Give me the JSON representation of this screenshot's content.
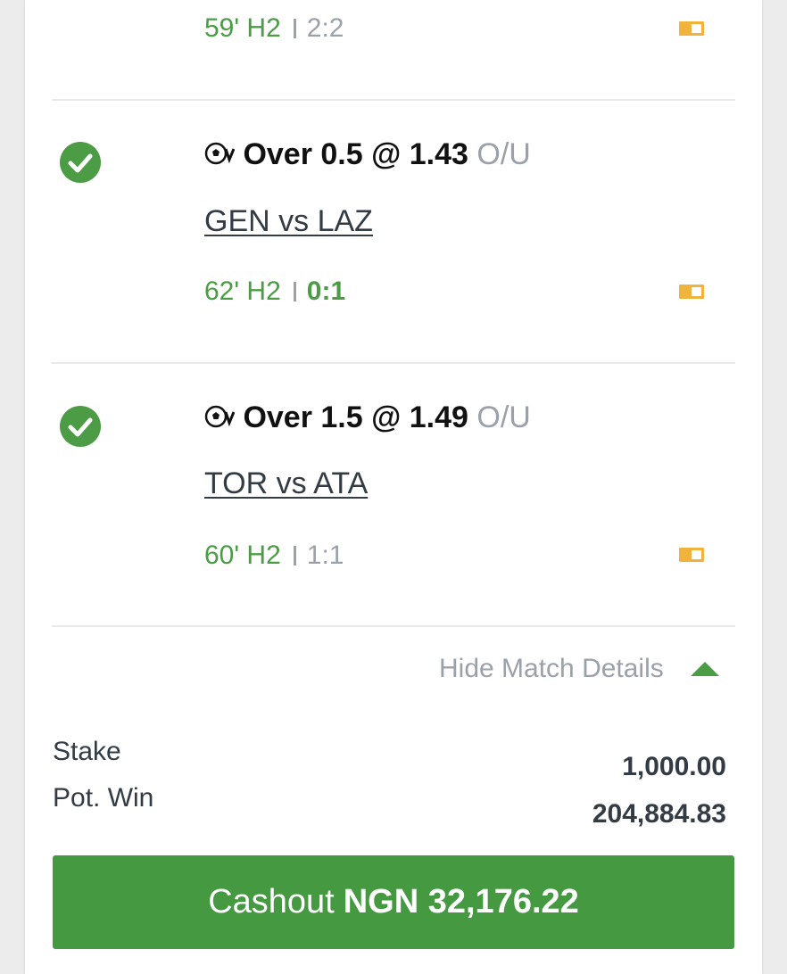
{
  "colors": {
    "accent_green": "#459a41",
    "text_green": "#4b9c45",
    "muted_grey": "#9aa1aa",
    "flag_yellow": "#f0b43c"
  },
  "bets": [
    {
      "status_icon": "check-circle-icon",
      "live": {
        "minute": "59' H2",
        "score": "2:2"
      }
    },
    {
      "status_icon": "check-circle-icon",
      "selection": "Over 0.5",
      "at": "@",
      "odds": "1.43",
      "market": "O/U",
      "match": "GEN vs LAZ",
      "live": {
        "minute": "62' H2",
        "score": "0:1"
      }
    },
    {
      "status_icon": "check-circle-icon",
      "selection": "Over 1.5",
      "at": "@",
      "odds": "1.49",
      "market": "O/U",
      "match": "TOR vs ATA",
      "live": {
        "minute": "60' H2",
        "score": "1:1"
      }
    }
  ],
  "details_toggle": {
    "label": "Hide Match Details"
  },
  "summary": {
    "stake_label": "Stake",
    "stake_value": "1,000.00",
    "potwin_label": "Pot. Win",
    "potwin_value": "204,884.83"
  },
  "cashout": {
    "label": "Cashout",
    "amount": "NGN 32,176.22"
  }
}
